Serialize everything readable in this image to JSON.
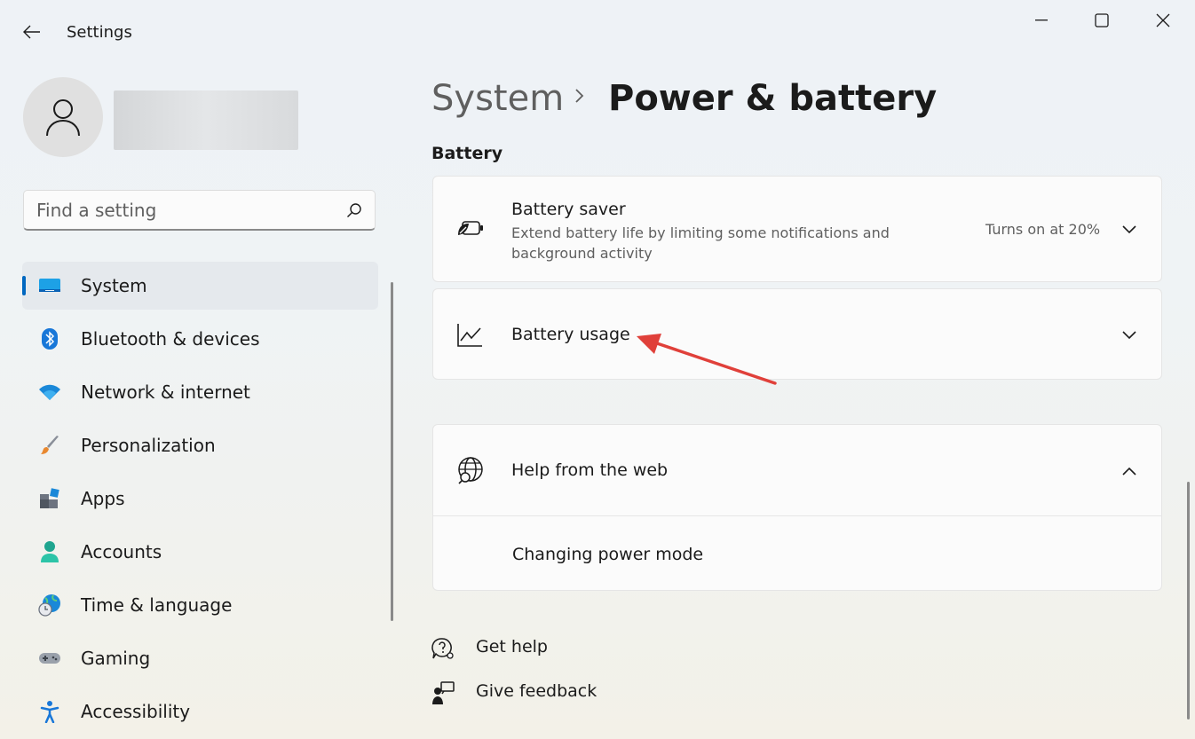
{
  "window": {
    "title": "Settings",
    "controls": [
      "minimize",
      "maximize",
      "close"
    ]
  },
  "search": {
    "placeholder": "Find a setting",
    "value": ""
  },
  "sidebar": {
    "items": [
      {
        "label": "System",
        "icon": "system-display-icon",
        "selected": true
      },
      {
        "label": "Bluetooth & devices",
        "icon": "bluetooth-icon"
      },
      {
        "label": "Network & internet",
        "icon": "wifi-icon"
      },
      {
        "label": "Personalization",
        "icon": "paintbrush-icon"
      },
      {
        "label": "Apps",
        "icon": "apps-icon"
      },
      {
        "label": "Accounts",
        "icon": "person-icon"
      },
      {
        "label": "Time & language",
        "icon": "globe-clock-icon"
      },
      {
        "label": "Gaming",
        "icon": "gamepad-icon"
      },
      {
        "label": "Accessibility",
        "icon": "accessibility-icon"
      }
    ]
  },
  "breadcrumb": {
    "parent": "System",
    "current": "Power & battery"
  },
  "sections": {
    "battery_heading": "Battery"
  },
  "battery_saver": {
    "title": "Battery saver",
    "description": "Extend battery life by limiting some notifications and background activity",
    "status": "Turns on at 20%",
    "icon": "battery-leaf-icon"
  },
  "battery_usage": {
    "title": "Battery usage",
    "icon": "line-chart-icon"
  },
  "help": {
    "title": "Help from the web",
    "icon": "globe-search-icon",
    "links": [
      "Changing power mode"
    ]
  },
  "footer": {
    "get_help": "Get help",
    "give_feedback": "Give feedback"
  },
  "colors": {
    "accent": "#0067c0",
    "annotation_arrow": "#e0403a"
  }
}
